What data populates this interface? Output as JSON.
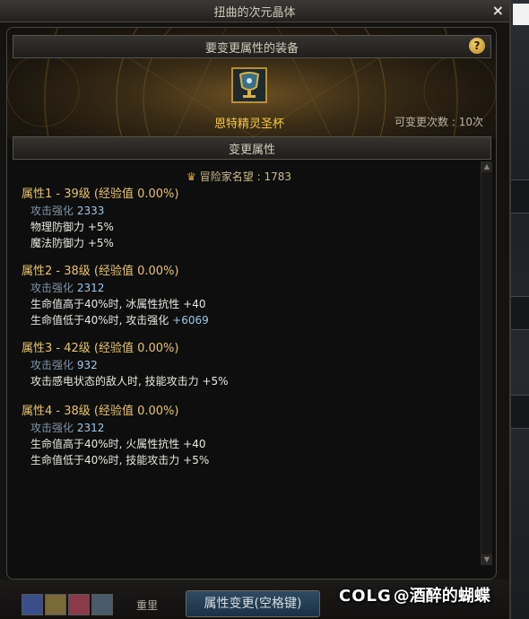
{
  "window": {
    "title": "扭曲的次元晶体",
    "close_glyph": "×"
  },
  "header": {
    "equipment_label": "要变更属性的装备",
    "help_glyph": "?",
    "item_name": "恩特精灵圣杯",
    "change_count": "可变更次数 : 10次",
    "change_attr_label": "变更属性"
  },
  "reputation": {
    "icon": "crown-icon",
    "text": "冒险家名望 : 1783"
  },
  "properties": [
    {
      "title": "属性1 - 39级 (经验值 0.00%)",
      "attack_label": "攻击强化",
      "attack_value": "2333",
      "lines": [
        {
          "text": "物理防御力",
          "value": "+5%"
        },
        {
          "text": "魔法防御力",
          "value": "+5%"
        }
      ]
    },
    {
      "title": "属性2 - 38级 (经验值 0.00%)",
      "attack_label": "攻击强化",
      "attack_value": "2312",
      "lines": [
        {
          "text": "生命值高于40%时, 冰属性抗性",
          "value": "+40"
        },
        {
          "text": "生命值低于40%时, 攻击强化",
          "value": "+6069"
        }
      ]
    },
    {
      "title": "属性3 - 42级 (经验值 0.00%)",
      "attack_label": "攻击强化",
      "attack_value": "932",
      "lines": [
        {
          "text": "攻击感电状态的敌人时, 技能攻击力",
          "value": "+5%"
        }
      ]
    },
    {
      "title": "属性4 - 38级 (经验值 0.00%)",
      "attack_label": "攻击强化",
      "attack_value": "2312",
      "lines": [
        {
          "text": "生命值高于40%时, 火属性抗性",
          "value": "+40"
        },
        {
          "text": "生命值低于40%时, 技能攻击力",
          "value": "+5%"
        }
      ]
    }
  ],
  "footer": {
    "weight_label": "重里",
    "apply_button": "属性变更(空格键)"
  },
  "watermark": {
    "logo": "COLG",
    "text": "@酒醉的蝴蝶"
  },
  "colors": {
    "title_gold": "#e6c46a",
    "item_name": "#f2c83a",
    "value_blue": "#9ec6ea",
    "button_blue": "#2f4b63"
  }
}
